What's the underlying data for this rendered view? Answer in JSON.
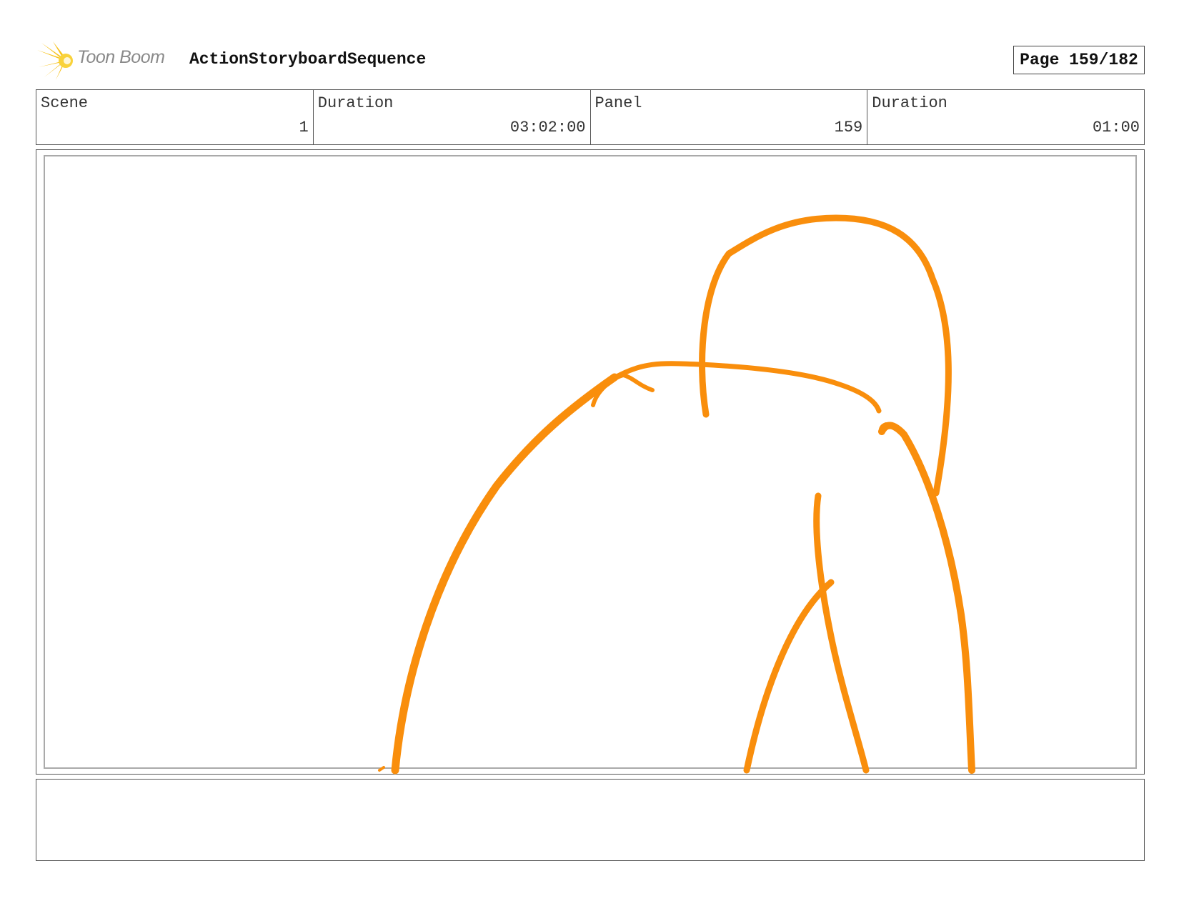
{
  "header": {
    "logo_text": "Toon Boom",
    "project_title": "ActionStoryboardSequence",
    "page_label": "Page 159/182"
  },
  "info": {
    "scene_label": "Scene",
    "scene_value": "1",
    "scene_duration_label": "Duration",
    "scene_duration_value": "03:02:00",
    "panel_label": "Panel",
    "panel_value": "159",
    "panel_duration_label": "Duration",
    "panel_duration_value": "01:00"
  },
  "notes": {
    "text": ""
  },
  "colors": {
    "sketch_stroke": "#F98E0C",
    "logo_yellow": "#F7C21B"
  }
}
